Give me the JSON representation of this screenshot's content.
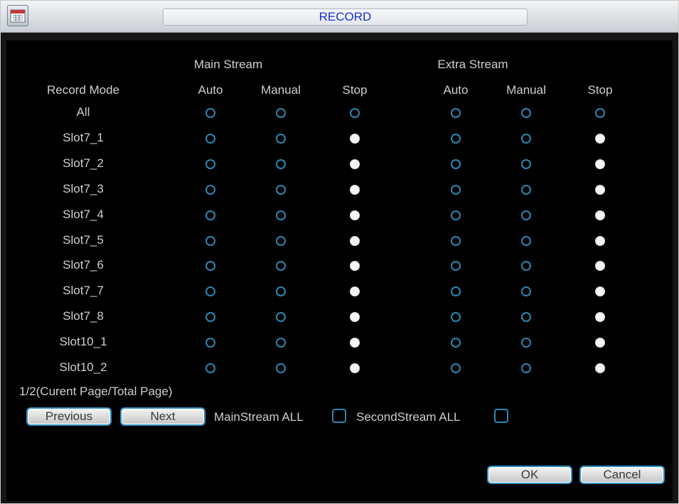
{
  "window": {
    "title": "RECORD"
  },
  "headers": {
    "main_stream": "Main Stream",
    "extra_stream": "Extra Stream",
    "record_mode": "Record Mode",
    "columns": [
      "Auto",
      "Manual",
      "Stop",
      "Auto",
      "Manual",
      "Stop"
    ]
  },
  "rows": [
    {
      "label": "All",
      "selected_main": null,
      "selected_extra": null
    },
    {
      "label": "Slot7_1",
      "selected_main": "Stop",
      "selected_extra": "Stop"
    },
    {
      "label": "Slot7_2",
      "selected_main": "Stop",
      "selected_extra": "Stop"
    },
    {
      "label": "Slot7_3",
      "selected_main": "Stop",
      "selected_extra": "Stop"
    },
    {
      "label": "Slot7_4",
      "selected_main": "Stop",
      "selected_extra": "Stop"
    },
    {
      "label": "Slot7_5",
      "selected_main": "Stop",
      "selected_extra": "Stop"
    },
    {
      "label": "Slot7_6",
      "selected_main": "Stop",
      "selected_extra": "Stop"
    },
    {
      "label": "Slot7_7",
      "selected_main": "Stop",
      "selected_extra": "Stop"
    },
    {
      "label": "Slot7_8",
      "selected_main": "Stop",
      "selected_extra": "Stop"
    },
    {
      "label": "Slot10_1",
      "selected_main": "Stop",
      "selected_extra": "Stop"
    },
    {
      "label": "Slot10_2",
      "selected_main": "Stop",
      "selected_extra": "Stop"
    }
  ],
  "page_info": "1/2(Curent Page/Total Page)",
  "buttons": {
    "previous": "Previous",
    "next": "Next",
    "ok": "OK",
    "cancel": "Cancel"
  },
  "checkboxes": {
    "main_all_label": "MainStream ALL",
    "main_all_checked": false,
    "second_all_label": "SecondStream ALL",
    "second_all_checked": false
  },
  "colors": {
    "title_text": "#1a2fd0",
    "radio_border": "#2d86b3",
    "label_text": "#cfcfcf",
    "background": "#000000"
  },
  "icons": {
    "app": "record-calendar-icon"
  }
}
